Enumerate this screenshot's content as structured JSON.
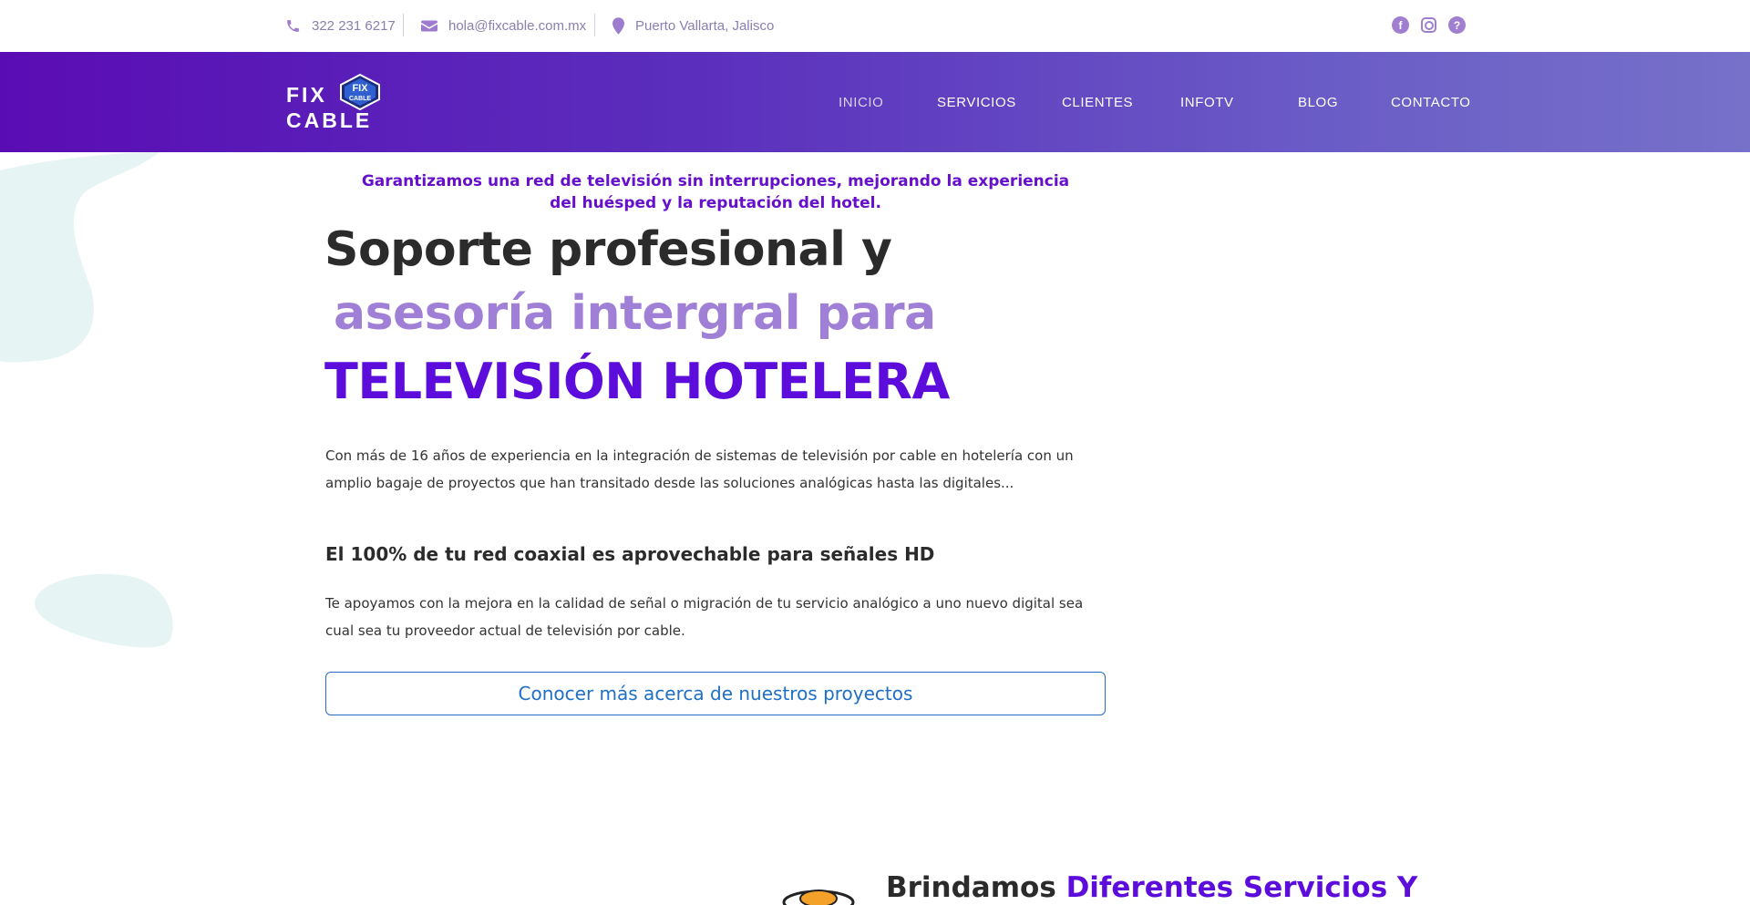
{
  "topbar": {
    "phone": "322 231 6217",
    "email": "hola@fixcable.com.mx",
    "location": "Puerto Vallarta, Jalisco",
    "icons": [
      "phone-icon",
      "envelope-icon",
      "map-pin-icon",
      "facebook-icon",
      "instagram-icon",
      "help-icon"
    ]
  },
  "logo": {
    "line1": "FIX",
    "line2": "CABLE",
    "badge_top": "FIX",
    "badge_bottom": "CABLE"
  },
  "nav": {
    "items": [
      {
        "label": "INICIO",
        "active": true
      },
      {
        "label": "SERVICIOS"
      },
      {
        "label": "CLIENTES"
      },
      {
        "label": "INFOTV"
      },
      {
        "label": "BLOG"
      },
      {
        "label": "CONTACTO"
      }
    ]
  },
  "hero": {
    "tagline": "Garantizamos una red de televisión sin interrupciones, mejorando la experiencia del huésped y la reputación del hotel.",
    "title_line1": "Soporte profesional y",
    "title_line2": "asesoría intergral para",
    "title_line3": "TELEVISIÓN HOTELERA",
    "intro": "Con más de 16 años de experiencia en la integración de sistemas de televisión por cable en hotelería con un amplio bagaje de proyectos que han transitado desde las soluciones analógicas hasta las digitales...",
    "subheading": "El 100% de tu red coaxial es aprovechable para señales HD",
    "support_text": "Te apoyamos con la mejora en la calidad de señal o migración de tu servicio analógico a uno nuevo digital sea cual sea tu proveedor actual de televisión por cable.",
    "cta_label": "Conocer más acerca de nuestros proyectos"
  },
  "services": {
    "title_plain": "Brindamos ",
    "title_highlight": "Diferentes Servicios Y"
  },
  "colors": {
    "accent": "#5d0ddb",
    "accent_light": "#a07fd6",
    "nav_gradient_start": "#5a0cb4",
    "nav_gradient_end": "#7671c9",
    "link_blue": "#1f6fc5",
    "blob": "#e6f4f4"
  }
}
